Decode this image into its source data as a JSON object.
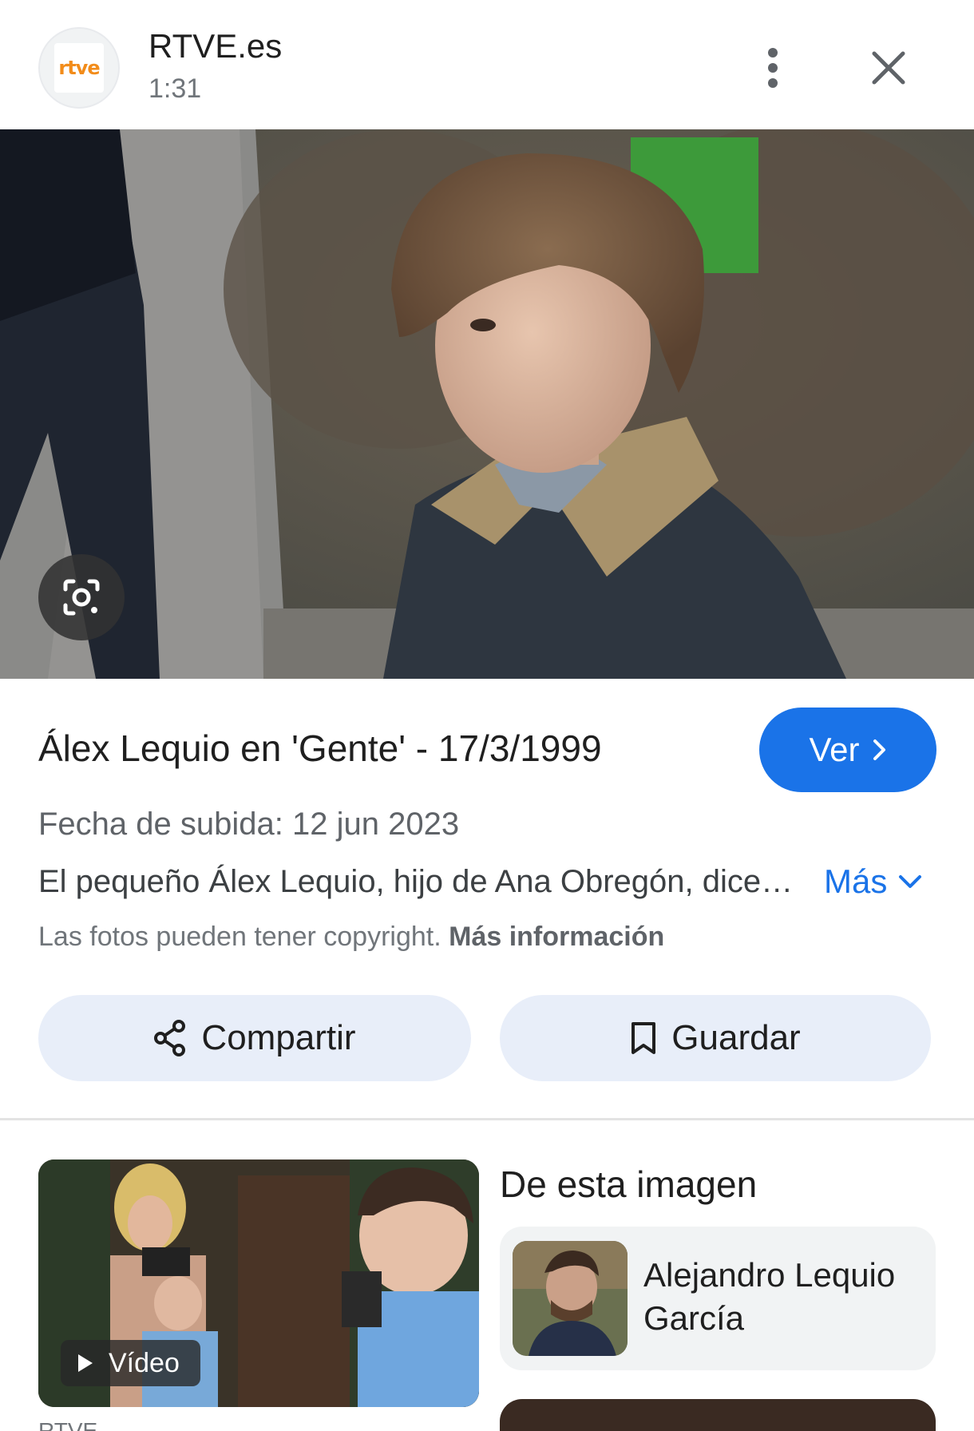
{
  "header": {
    "logo_text": "rtve",
    "site_name": "RTVE.es",
    "duration": "1:31",
    "menu_icon": "more-vert-icon",
    "close_icon": "close-icon"
  },
  "hero": {
    "lens_icon": "google-lens-icon"
  },
  "info": {
    "title": "Álex Lequio en 'Gente' - 17/3/1999",
    "view_button": "Ver",
    "upload_date": "Fecha de subida: 12 jun 2023",
    "description": "El pequeño Álex Lequio, hijo de Ana Obregón, dice…",
    "more_button": "Más",
    "copyright_text": "Las fotos pueden tener copyright.",
    "copyright_link": "Más información"
  },
  "actions": {
    "share_label": "Compartir",
    "save_label": "Guardar"
  },
  "related": {
    "video_label": "Vídeo",
    "source_label": "RTVE",
    "section_title": "De esta imagen",
    "entity_name": "Alejandro Lequio García"
  },
  "colors": {
    "accent": "#1a73e8",
    "button_bg": "#e8eef9",
    "card_bg": "#f1f3f4"
  }
}
